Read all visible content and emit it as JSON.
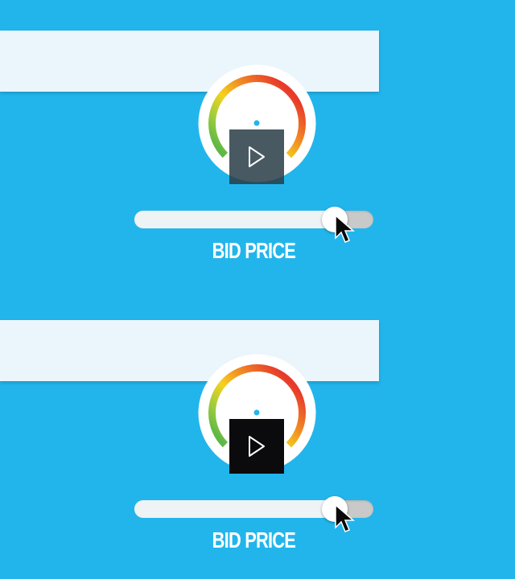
{
  "colors": {
    "background": "#22b5ec",
    "bar": "#eaf5fc",
    "gauge_gradient": [
      "#e83a2a",
      "#f08a24",
      "#f5d21e",
      "#9ccc3c",
      "#5fb846"
    ],
    "play_top": "#283c46",
    "play_bottom": "#0b0b0d"
  },
  "icons": {
    "play": "play-triangle-icon",
    "gauge": "speedometer-icon",
    "cursor": "mouse-pointer-icon"
  },
  "panels": [
    {
      "label": "BID PRICE",
      "slider_value_fraction": 0.84
    },
    {
      "label": "BID PRICE",
      "slider_value_fraction": 0.84
    }
  ]
}
